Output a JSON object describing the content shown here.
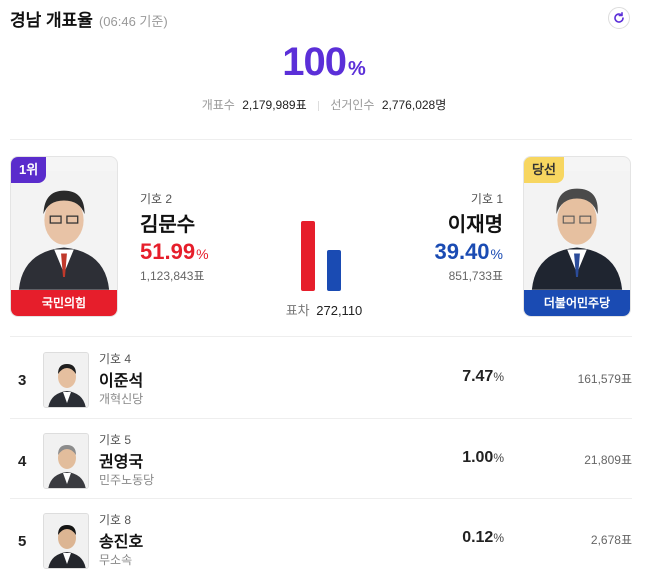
{
  "header": {
    "title": "경남 개표율",
    "time": "(06:46 기준)"
  },
  "rate": {
    "value": "100",
    "unit": "%"
  },
  "counts": {
    "counted_label": "개표수",
    "counted_value": "2,179,989표",
    "voters_label": "선거인수",
    "voters_value": "2,776,028명"
  },
  "top": {
    "left": {
      "badge": "1위",
      "no": "기호 2",
      "name": "김문수",
      "pct": "51.99",
      "pct_unit": "%",
      "votes": "1,123,843표",
      "party": "국민의힘",
      "color": "#e61e2b",
      "share": 51.99
    },
    "right": {
      "badge": "당선",
      "no": "기호 1",
      "name": "이재명",
      "pct": "39.40",
      "pct_unit": "%",
      "votes": "851,733표",
      "party": "더불어민주당",
      "color": "#1a4bb3",
      "share": 39.4
    },
    "gap_label": "표차",
    "gap_value": "272,110"
  },
  "others": [
    {
      "rank": "3",
      "no": "기호 4",
      "name": "이준석",
      "party": "개혁신당",
      "pct": "7.47",
      "pct_unit": "%",
      "votes": "161,579표"
    },
    {
      "rank": "4",
      "no": "기호 5",
      "name": "권영국",
      "party": "민주노동당",
      "pct": "1.00",
      "pct_unit": "%",
      "votes": "21,809표"
    },
    {
      "rank": "5",
      "no": "기호 8",
      "name": "송진호",
      "party": "무소속",
      "pct": "0.12",
      "pct_unit": "%",
      "votes": "2,678표"
    }
  ],
  "icons": {
    "refresh": "refresh-icon"
  },
  "colors": {
    "accent": "#5b2fd8",
    "red": "#e61e2b",
    "blue": "#1a4bb3"
  }
}
